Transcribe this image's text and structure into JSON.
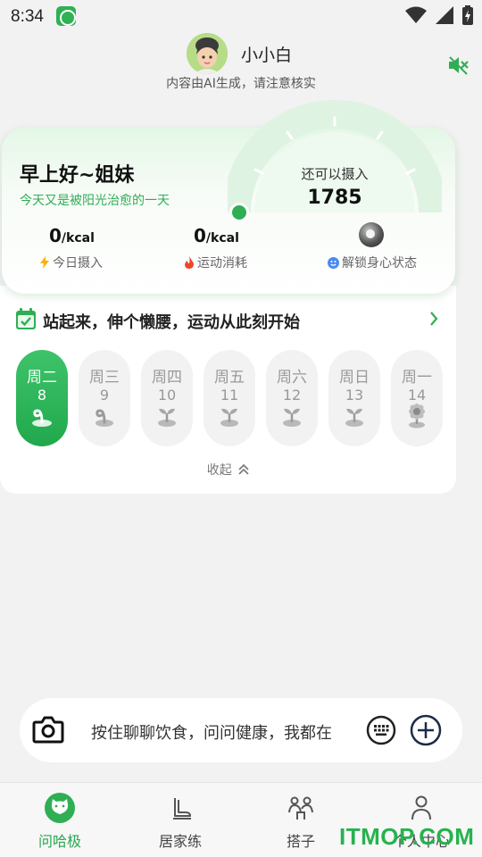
{
  "status_bar": {
    "time": "8:34",
    "icons": [
      "app-notification-icon",
      "wifi-icon",
      "signal-icon",
      "battery-charging-icon"
    ]
  },
  "header": {
    "username": "小小白",
    "ai_notice": "内容由AI生成，请注意核实",
    "mute_icon": "volume-muted-icon"
  },
  "summary": {
    "greeting": "早上好~姐妹",
    "subtitle": "今天又是被阳光治愈的一天",
    "gauge_label": "还可以摄入",
    "gauge_value": "1785",
    "intake_value": "0",
    "intake_unit": "/kcal",
    "intake_label": "今日摄入",
    "burn_value": "0",
    "burn_unit": "/kcal",
    "burn_label": "运动消耗",
    "unlock_label": "解锁身心状态"
  },
  "plan": {
    "title": "站起来，伸个懒腰，运动从此刻开始"
  },
  "days": [
    {
      "name": "周二",
      "num": "8",
      "active": true
    },
    {
      "name": "周三",
      "num": "9"
    },
    {
      "name": "周四",
      "num": "10"
    },
    {
      "name": "周五",
      "num": "11"
    },
    {
      "name": "周六",
      "num": "12"
    },
    {
      "name": "周日",
      "num": "13"
    },
    {
      "name": "周一",
      "num": "14"
    }
  ],
  "collapse_label": "收起",
  "input": {
    "placeholder": "按住聊聊饮食，问问健康，我都在"
  },
  "nav": [
    {
      "label": "问哈极",
      "icon": "cat-face-icon",
      "active": true
    },
    {
      "label": "居家练",
      "icon": "leg-stretch-icon"
    },
    {
      "label": "搭子",
      "icon": "buddies-icon"
    },
    {
      "label": "个人中心",
      "icon": "person-icon"
    }
  ],
  "watermark": "ITMOP.COM",
  "colors": {
    "accent": "#2fae54",
    "background": "#f2f2f2"
  }
}
